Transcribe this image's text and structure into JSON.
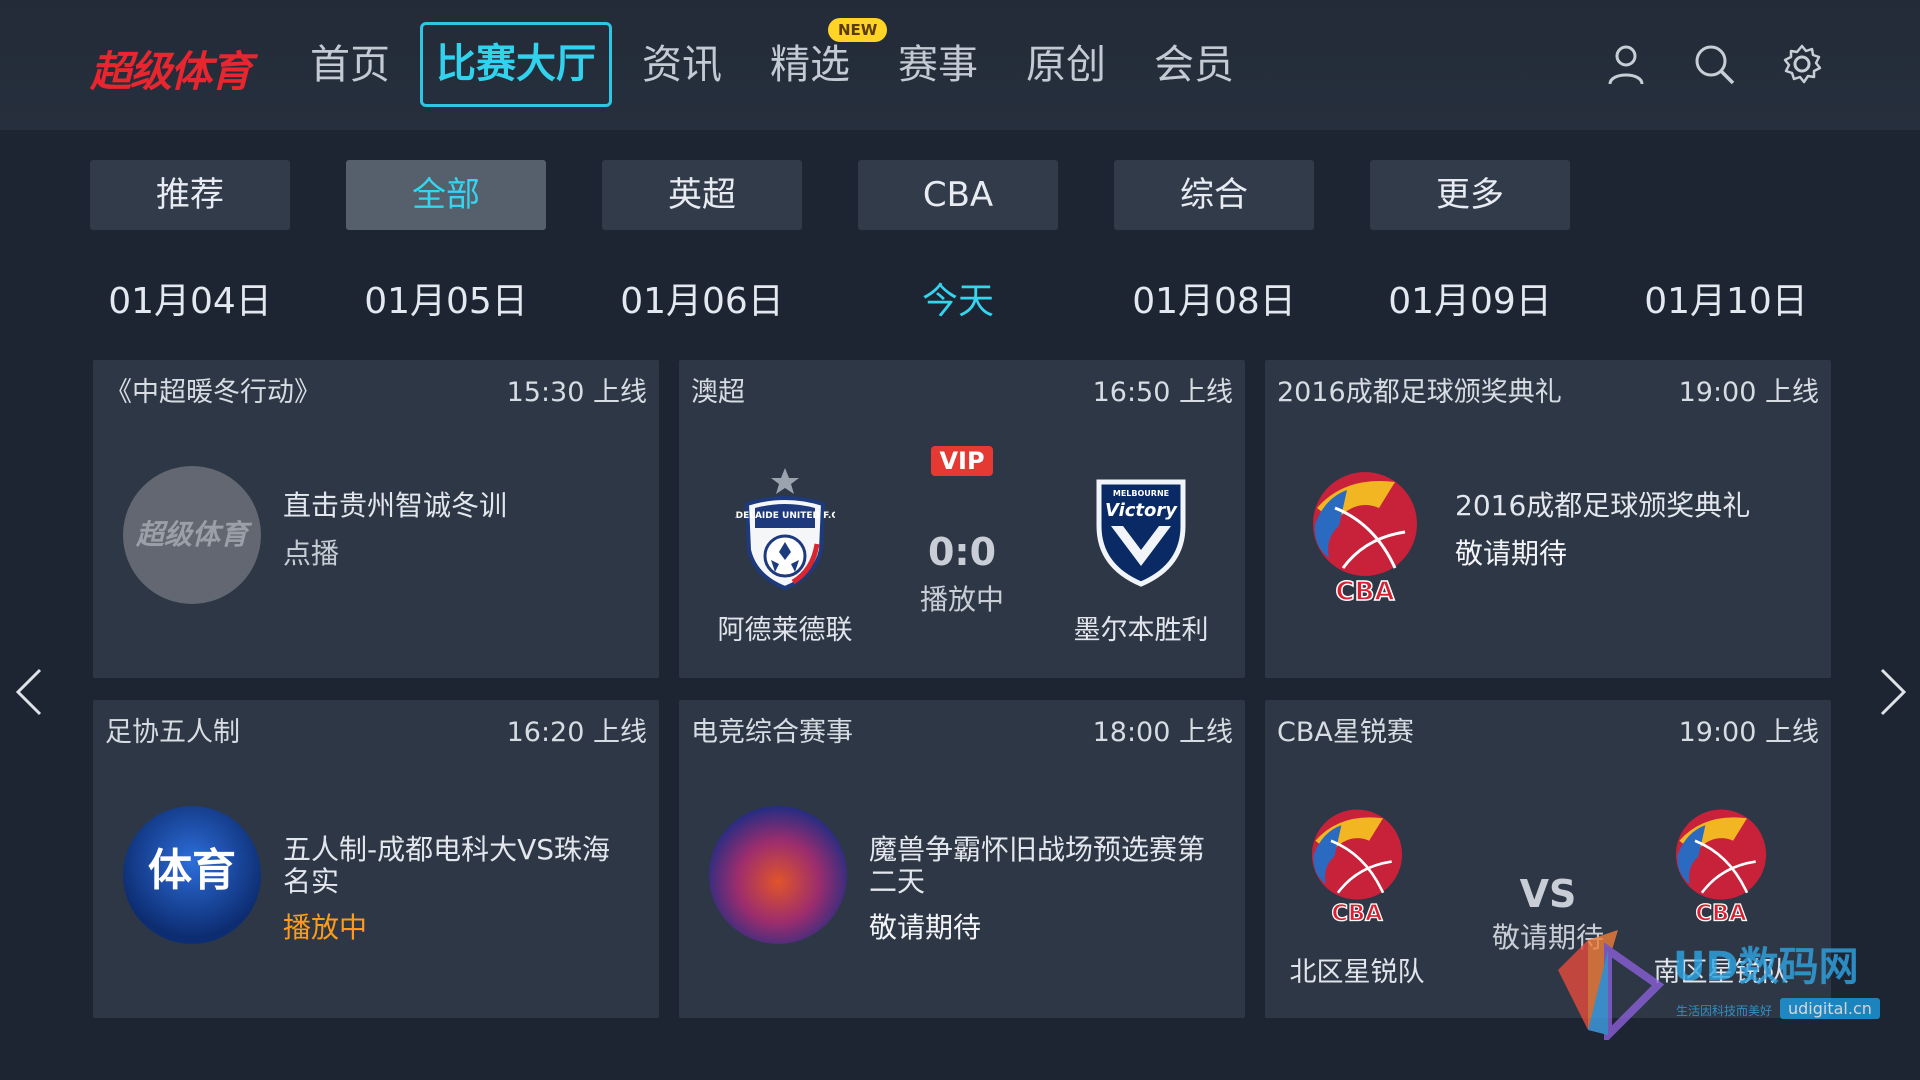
{
  "brand": {
    "logo_text": "超级体育"
  },
  "nav": {
    "items": [
      "首页",
      "比赛大厅",
      "资讯",
      "精选",
      "赛事",
      "原创",
      "会员"
    ],
    "active_index": 1,
    "new_badge": "NEW"
  },
  "categories": [
    "推荐",
    "全部",
    "英超",
    "CBA",
    "综合",
    "更多"
  ],
  "dates": [
    "01月04日",
    "01月05日",
    "01月06日",
    "今天",
    "01月08日",
    "01月09日",
    "01月10日"
  ],
  "cards": [
    {
      "category": "《中超暖冬行动》",
      "time": "15:30 上线",
      "thumb_text": "超级体育",
      "title": "直击贵州智诚冬训",
      "status": "点播"
    },
    {
      "category": "澳超",
      "time": "16:50 上线",
      "vip": "VIP",
      "score": "0:0",
      "status": "播放中",
      "home_team": "阿德莱德联",
      "away_team": "墨尔本胜利",
      "home_crest": "ADELAIDE UNITED F.C.",
      "away_crest": "Victory",
      "away_crest_top": "MELBOURNE"
    },
    {
      "category": "2016成都足球颁奖典礼",
      "time": "19:00 上线",
      "title": "2016成都足球颁奖典礼",
      "status": "敬请期待"
    },
    {
      "category": "足协五人制",
      "time": "16:20 上线",
      "thumb_text": "体育",
      "title": "五人制-成都电科大VS珠海名实",
      "status": "播放中"
    },
    {
      "category": "电竞综合赛事",
      "time": "18:00 上线",
      "title": "魔兽争霸怀旧战场预选赛第二天",
      "status": "敬请期待"
    },
    {
      "category": "CBA星锐赛",
      "time": "19:00 上线",
      "vs": "VS",
      "status": "敬请期待",
      "home_team": "北区星锐队",
      "away_team": "南区星锐队"
    }
  ],
  "watermark": {
    "text": "UD数码网",
    "sub": "生活因科技而美好",
    "url": "udigital.cn"
  },
  "colors": {
    "accent": "#35d4ef",
    "playing": "#ff9b1a",
    "brand_red": "#e8262f",
    "vip_red": "#e43a33"
  }
}
